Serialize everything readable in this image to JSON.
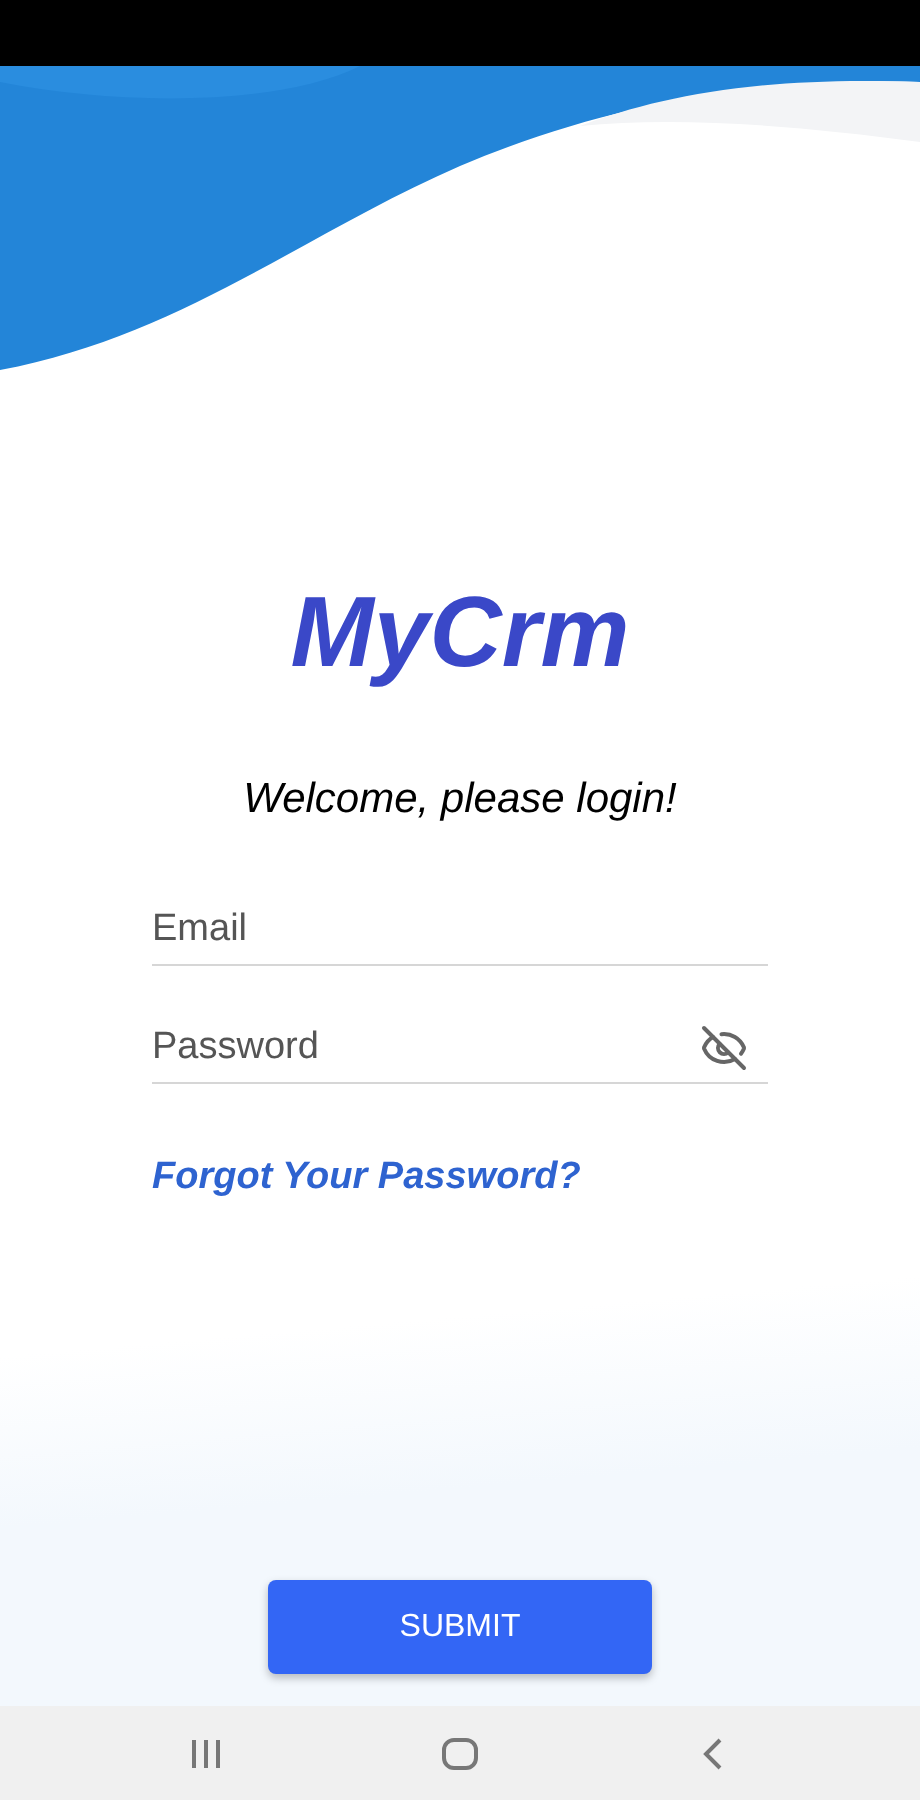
{
  "logo": "MyCrm",
  "greeting": "Welcome, please login!",
  "fields": [
    {
      "kind": "email",
      "placeholder": "Email"
    },
    {
      "kind": "password",
      "placeholder": "Password",
      "password_visible": false
    }
  ],
  "forgot_link": "Forgot Your Password?",
  "submit": "SUBMIT"
}
